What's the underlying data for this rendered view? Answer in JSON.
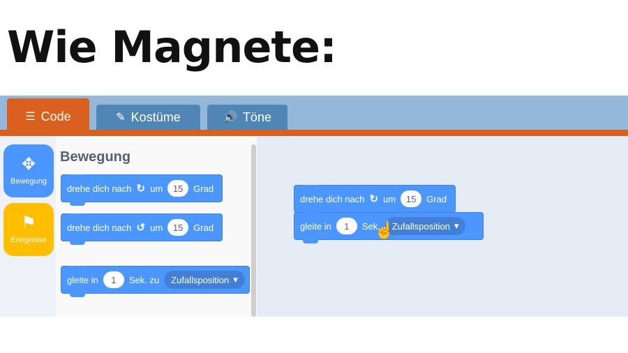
{
  "headline": "Wie Magnete:",
  "tabs": [
    {
      "label": "Code",
      "icon": "code-icon"
    },
    {
      "label": "Kostüme",
      "icon": "brush-icon"
    },
    {
      "label": "Töne",
      "icon": "speaker-icon"
    }
  ],
  "categories": [
    {
      "label": "Bewegung",
      "icon": "move-arrows-icon",
      "color": "#4c97ff"
    },
    {
      "label": "Ereignisse",
      "icon": "flag-icon",
      "color": "#ffbf00"
    }
  ],
  "palette": {
    "title": "Bewegung",
    "blocks": [
      {
        "text": "drehe dich nach",
        "arrow": "↻",
        "um": "um",
        "value": "15",
        "unit": "Grad"
      },
      {
        "text": "drehe dich nach",
        "arrow": "↺",
        "um": "um",
        "value": "15",
        "unit": "Grad"
      },
      {
        "text": "gleite in",
        "value": "1",
        "sek": "Sek. zu",
        "dropdown": "Zufallsposition"
      }
    ]
  },
  "workspace": {
    "blocks": [
      {
        "text": "drehe dich nach",
        "arrow": "↻",
        "um": "um",
        "value": "15",
        "unit": "Grad"
      },
      {
        "text": "gleite in",
        "value": "1",
        "sek": "Sek.",
        "dropdown": "Zufallsposition"
      }
    ]
  },
  "colors": {
    "motion": "#4c97ff",
    "accent": "#d9601e",
    "tab_inactive": "#4f86b6"
  }
}
